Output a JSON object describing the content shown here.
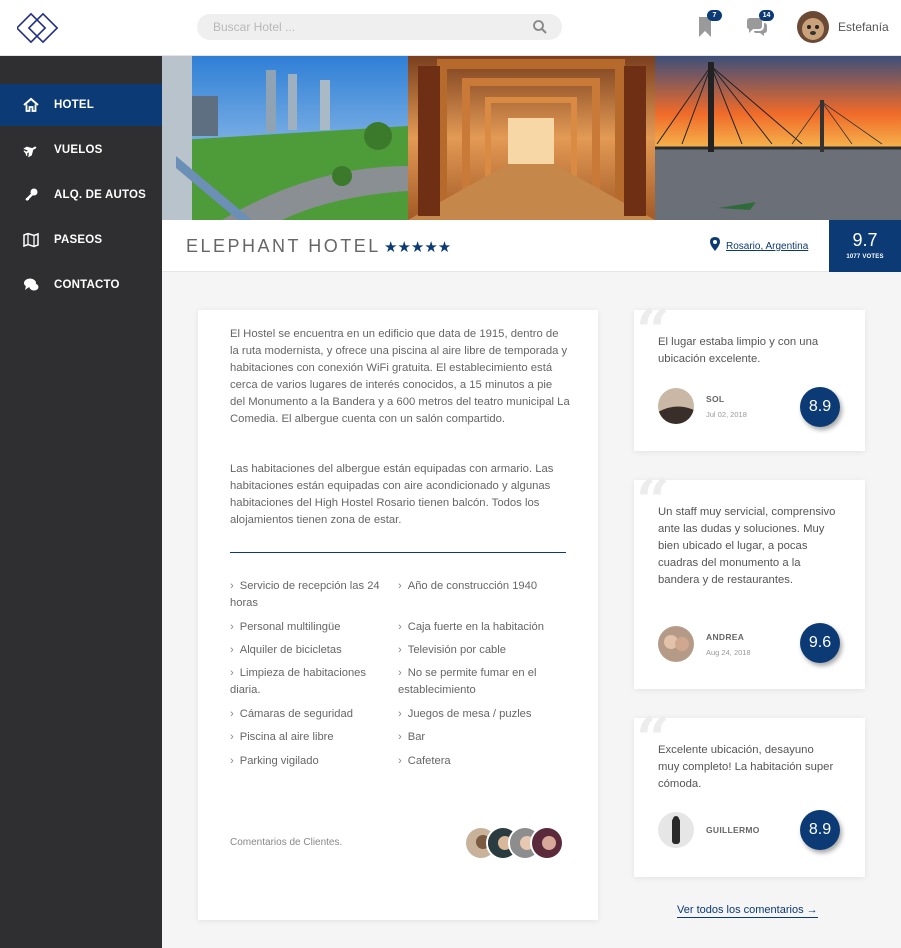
{
  "header": {
    "search_placeholder": "Buscar Hotel ...",
    "bookmarks_count": "7",
    "messages_count": "14",
    "user_name": "Estefanía"
  },
  "sidebar": {
    "items": [
      {
        "label": "HOTEL",
        "icon": "home-icon",
        "active": true
      },
      {
        "label": "VUELOS",
        "icon": "plane-icon",
        "active": false
      },
      {
        "label": "ALQ. DE AUTOS",
        "icon": "key-icon",
        "active": false
      },
      {
        "label": "PASEOS",
        "icon": "map-icon",
        "active": false
      },
      {
        "label": "CONTACTO",
        "icon": "chat-icon",
        "active": false
      }
    ]
  },
  "hotel": {
    "name": "ELEPHANT HOTEL",
    "stars": "★★★★★",
    "rating_stars": 5,
    "location": "Rosario, Argentina",
    "score": "9.7",
    "votes": "1077 VOTES",
    "description_1": "El Hostel se encuentra en un edificio que data de 1915, dentro de la ruta modernista, y ofrece una piscina al aire libre de temporada y habitaciones con conexión WiFi gratuita. El establecimiento está cerca de varios lugares de interés conocidos, a 15 minutos a pie del Monumento a la Bandera y a 600 metros del teatro municipal La Comedia. El albergue cuenta con un salón compartido.",
    "description_2": "Las habitaciones del albergue están equipadas con armario. Las habitaciones están equipadas con aire acondicionado y algunas habitaciones del High Hostel Rosario tienen balcón. Todos los alojamientos tienen zona de estar.",
    "amenities": [
      "Servicio de recepción las 24 horas",
      "Año de construcción 1940",
      "Personal multilingüe",
      "Caja fuerte en la habitación",
      "Alquiler de bicicletas",
      "Televisión por cable",
      "Limpieza de habitaciones diaria.",
      "No se permite fumar en el establecimiento",
      "Cámaras de seguridad",
      "Juegos de mesa / puzles",
      "Piscina al aire libre",
      "Bar",
      "Parking vigilado",
      "Cafetera"
    ],
    "comments_label": "Comentarios de Clientes."
  },
  "reviews": [
    {
      "text": "El lugar estaba limpio y con una ubicación excelente.",
      "name": "SOL",
      "date": "Jul 02, 2018",
      "score": "8.9"
    },
    {
      "text": "Un staff muy servicial, comprensivo ante las dudas y soluciones. Muy bien ubicado el lugar, a pocas cuadras del monumento a la bandera y de restaurantes.",
      "name": "ANDREA",
      "date": "Aug 24, 2018",
      "score": "9.6"
    },
    {
      "text": "Excelente ubicación, desayuno muy completo! La habitación super cómoda.",
      "name": "GUILLERMO",
      "date": "",
      "score": "8.9"
    }
  ],
  "see_all": "Ver todos los comentarios  →",
  "colors": {
    "accent": "#0b3a75",
    "sidebar": "#2f2f31"
  }
}
